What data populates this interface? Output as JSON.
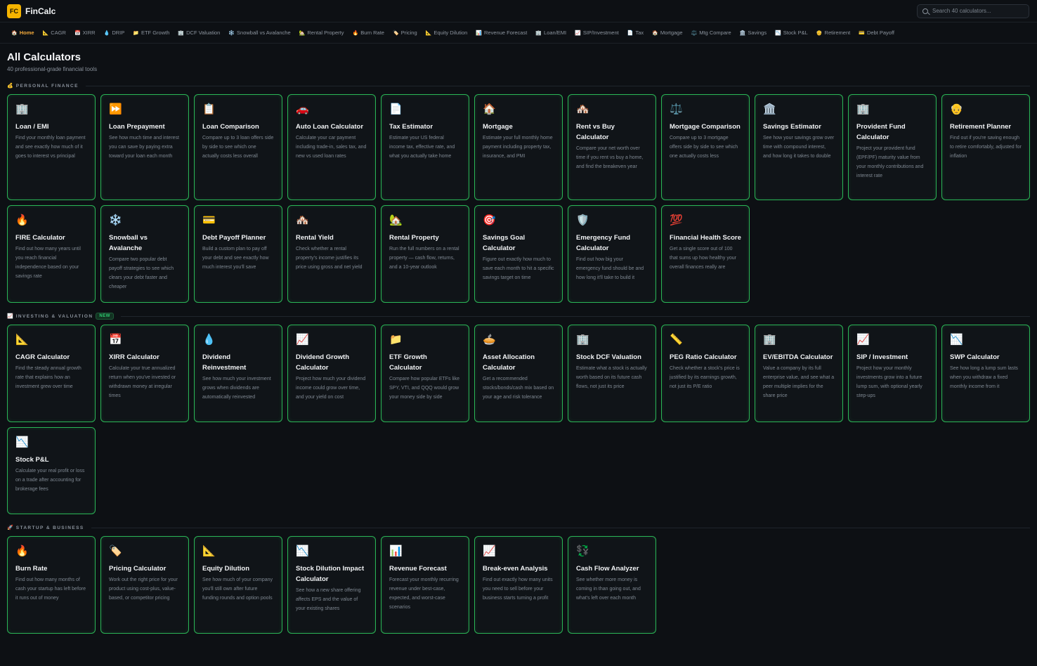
{
  "app": {
    "logo_text": "FC",
    "name": "FinCalc"
  },
  "search": {
    "placeholder": "Search 40 calculators..."
  },
  "tabs": [
    {
      "icon": "🏠",
      "label": "Home",
      "active": true
    },
    {
      "icon": "📐",
      "label": "CAGR"
    },
    {
      "icon": "📅",
      "label": "XIRR"
    },
    {
      "icon": "💧",
      "label": "DRIP"
    },
    {
      "icon": "📁",
      "label": "ETF Growth"
    },
    {
      "icon": "🏢",
      "label": "DCF Valuation"
    },
    {
      "icon": "❄️",
      "label": "Snowball vs Avalanche"
    },
    {
      "icon": "🏡",
      "label": "Rental Property"
    },
    {
      "icon": "🔥",
      "label": "Burn Rate"
    },
    {
      "icon": "🏷️",
      "label": "Pricing"
    },
    {
      "icon": "📐",
      "label": "Equity Dilution"
    },
    {
      "icon": "📊",
      "label": "Revenue Forecast"
    },
    {
      "icon": "🏢",
      "label": "Loan/EMI"
    },
    {
      "icon": "📈",
      "label": "SIP/Investment"
    },
    {
      "icon": "📄",
      "label": "Tax"
    },
    {
      "icon": "🏠",
      "label": "Mortgage"
    },
    {
      "icon": "⚖️",
      "label": "Mtg Compare"
    },
    {
      "icon": "🏛️",
      "label": "Savings"
    },
    {
      "icon": "📉",
      "label": "Stock P&L"
    },
    {
      "icon": "👴",
      "label": "Retirement"
    },
    {
      "icon": "💳",
      "label": "Debt Payoff"
    }
  ],
  "page": {
    "title": "All Calculators",
    "subtitle": "40 professional-grade financial tools"
  },
  "sections": [
    {
      "icon": "💰",
      "title": "PERSONAL FINANCE",
      "badge": "",
      "cards": [
        {
          "icon": "🏢",
          "title": "Loan / EMI",
          "desc": "Find your monthly loan payment and see exactly how much of it goes to interest vs principal"
        },
        {
          "icon": "⏩",
          "title": "Loan Prepayment",
          "desc": "See how much time and interest you can save by paying extra toward your loan each month"
        },
        {
          "icon": "📋",
          "title": "Loan Comparison",
          "desc": "Compare up to 3 loan offers side by side to see which one actually costs less overall"
        },
        {
          "icon": "🚗",
          "title": "Auto Loan Calculator",
          "desc": "Calculate your car payment including trade-in, sales tax, and new vs used loan rates"
        },
        {
          "icon": "📄",
          "title": "Tax Estimator",
          "desc": "Estimate your US federal income tax, effective rate, and what you actually take home"
        },
        {
          "icon": "🏠",
          "title": "Mortgage",
          "desc": "Estimate your full monthly home payment including property tax, insurance, and PMI"
        },
        {
          "icon": "🏘️",
          "title": "Rent vs Buy Calculator",
          "desc": "Compare your net worth over time if you rent vs buy a home, and find the breakeven year"
        },
        {
          "icon": "⚖️",
          "title": "Mortgage Comparison",
          "desc": "Compare up to 3 mortgage offers side by side to see which one actually costs less"
        },
        {
          "icon": "🏛️",
          "title": "Savings Estimator",
          "desc": "See how your savings grow over time with compound interest, and how long it takes to double"
        },
        {
          "icon": "🏢",
          "title": "Provident Fund Calculator",
          "desc": "Project your provident fund (EPF/PF) maturity value from your monthly contributions and interest rate"
        },
        {
          "icon": "👴",
          "title": "Retirement Planner",
          "desc": "Find out if you're saving enough to retire comfortably, adjusted for inflation"
        },
        {
          "icon": "🔥",
          "title": "FIRE Calculator",
          "desc": "Find out how many years until you reach financial independence based on your savings rate"
        },
        {
          "icon": "❄️",
          "title": "Snowball vs Avalanche",
          "desc": "Compare two popular debt payoff strategies to see which clears your debt faster and cheaper"
        },
        {
          "icon": "💳",
          "title": "Debt Payoff Planner",
          "desc": "Build a custom plan to pay off your debt and see exactly how much interest you'll save"
        },
        {
          "icon": "🏘️",
          "title": "Rental Yield",
          "desc": "Check whether a rental property's income justifies its price using gross and net yield"
        },
        {
          "icon": "🏡",
          "title": "Rental Property",
          "desc": "Run the full numbers on a rental property — cash flow, returns, and a 10-year outlook"
        },
        {
          "icon": "🎯",
          "title": "Savings Goal Calculator",
          "desc": "Figure out exactly how much to save each month to hit a specific savings target on time"
        },
        {
          "icon": "🛡️",
          "title": "Emergency Fund Calculator",
          "desc": "Find out how big your emergency fund should be and how long it'll take to build it"
        },
        {
          "icon": "💯",
          "title": "Financial Health Score",
          "desc": "Get a single score out of 100 that sums up how healthy your overall finances really are"
        }
      ]
    },
    {
      "icon": "📈",
      "title": "INVESTING & VALUATION",
      "badge": "NEW",
      "cards": [
        {
          "icon": "📐",
          "title": "CAGR Calculator",
          "desc": "Find the steady annual growth rate that explains how an investment grew over time"
        },
        {
          "icon": "📅",
          "title": "XIRR Calculator",
          "desc": "Calculate your true annualized return when you've invested or withdrawn money at irregular times"
        },
        {
          "icon": "💧",
          "title": "Dividend Reinvestment",
          "desc": "See how much your investment grows when dividends are automatically reinvested"
        },
        {
          "icon": "📈",
          "title": "Dividend Growth Calculator",
          "desc": "Project how much your dividend income could grow over time, and your yield on cost"
        },
        {
          "icon": "📁",
          "title": "ETF Growth Calculator",
          "desc": "Compare how popular ETFs like SPY, VTI, and QQQ would grow your money side by side"
        },
        {
          "icon": "🥧",
          "title": "Asset Allocation Calculator",
          "desc": "Get a recommended stocks/bonds/cash mix based on your age and risk tolerance"
        },
        {
          "icon": "🏢",
          "title": "Stock DCF Valuation",
          "desc": "Estimate what a stock is actually worth based on its future cash flows, not just its price"
        },
        {
          "icon": "📏",
          "title": "PEG Ratio Calculator",
          "desc": "Check whether a stock's price is justified by its earnings growth, not just its P/E ratio"
        },
        {
          "icon": "🏢",
          "title": "EV/EBITDA Calculator",
          "desc": "Value a company by its full enterprise value, and see what a peer multiple implies for the share price"
        },
        {
          "icon": "📈",
          "title": "SIP / Investment",
          "desc": "Project how your monthly investments grow into a future lump sum, with optional yearly step-ups"
        },
        {
          "icon": "📉",
          "title": "SWP Calculator",
          "desc": "See how long a lump sum lasts when you withdraw a fixed monthly income from it"
        },
        {
          "icon": "📉",
          "title": "Stock P&L",
          "desc": "Calculate your real profit or loss on a trade after accounting for brokerage fees"
        }
      ]
    },
    {
      "icon": "🚀",
      "title": "STARTUP & BUSINESS",
      "badge": "",
      "cards": [
        {
          "icon": "🔥",
          "title": "Burn Rate",
          "desc": "Find out how many months of cash your startup has left before it runs out of money"
        },
        {
          "icon": "🏷️",
          "title": "Pricing Calculator",
          "desc": "Work out the right price for your product using cost-plus, value-based, or competitor pricing"
        },
        {
          "icon": "📐",
          "title": "Equity Dilution",
          "desc": "See how much of your company you'll still own after future funding rounds and option pools"
        },
        {
          "icon": "📉",
          "title": "Stock Dilution Impact Calculator",
          "desc": "See how a new share offering affects EPS and the value of your existing shares"
        },
        {
          "icon": "📊",
          "title": "Revenue Forecast",
          "desc": "Forecast your monthly recurring revenue under best-case, expected, and worst-case scenarios"
        },
        {
          "icon": "📈",
          "title": "Break-even Analysis",
          "desc": "Find out exactly how many units you need to sell before your business starts turning a profit"
        },
        {
          "icon": "💱",
          "title": "Cash Flow Analyzer",
          "desc": "See whether more money is coming in than going out, and what's left over each month"
        }
      ]
    }
  ]
}
